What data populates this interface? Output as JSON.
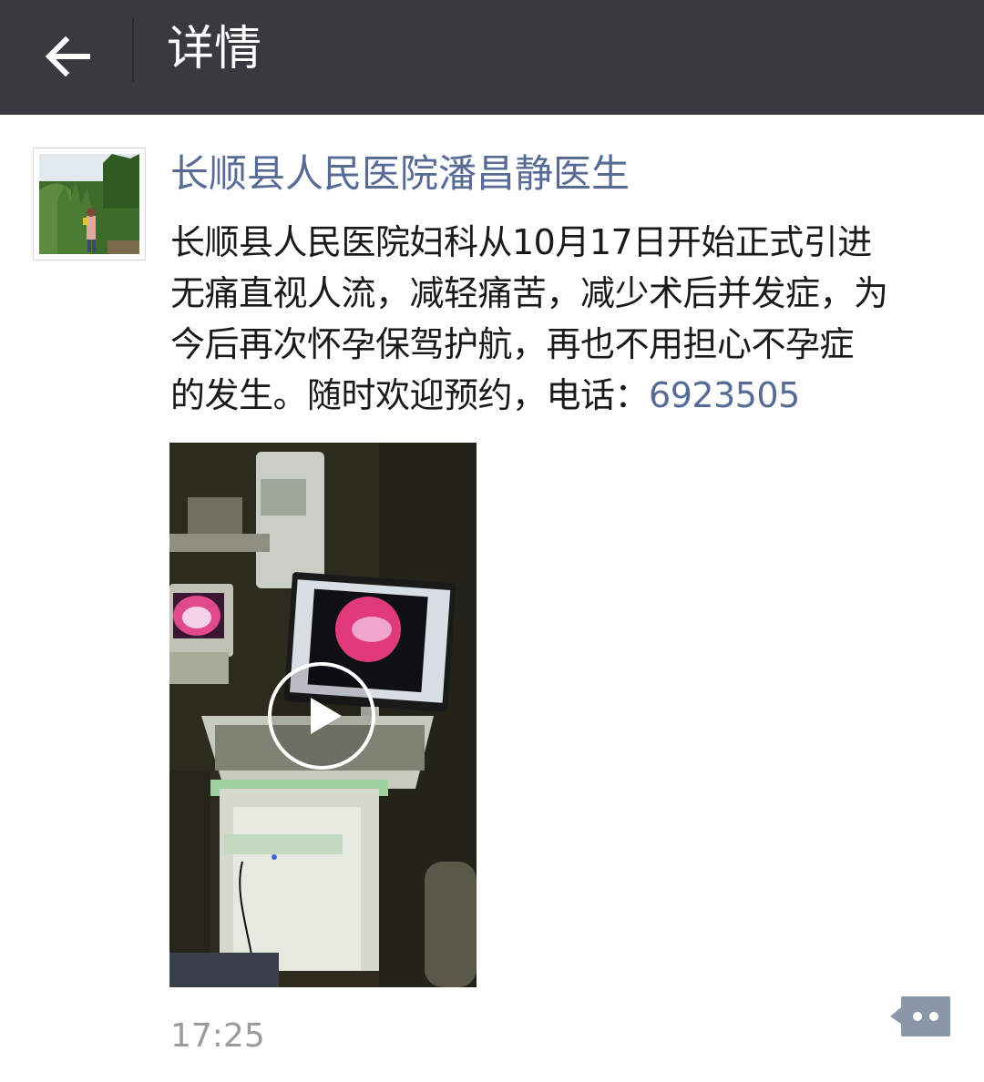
{
  "header": {
    "title": "详情"
  },
  "post": {
    "author": "长顺县人民医院潘昌静医生",
    "content_lines": [
      "长顺县人民医院妇科从10月17日开始正式引进",
      "无痛直视人流，减轻痛苦，减少术后并发症，为",
      "今后再次怀孕保驾护航，再也不用担心不孕症"
    ],
    "content_last_prefix": "的发生。随时欢迎预约，电话：",
    "phone": "6923505",
    "time": "17:25"
  },
  "icons": {
    "back": "arrow-left-icon",
    "play": "play-icon",
    "comment": "comment-bubble-icon"
  },
  "colors": {
    "topbar": "#393a3f",
    "link": "#576b95",
    "time": "#9b9b9b",
    "comment": "#8b96a8"
  }
}
